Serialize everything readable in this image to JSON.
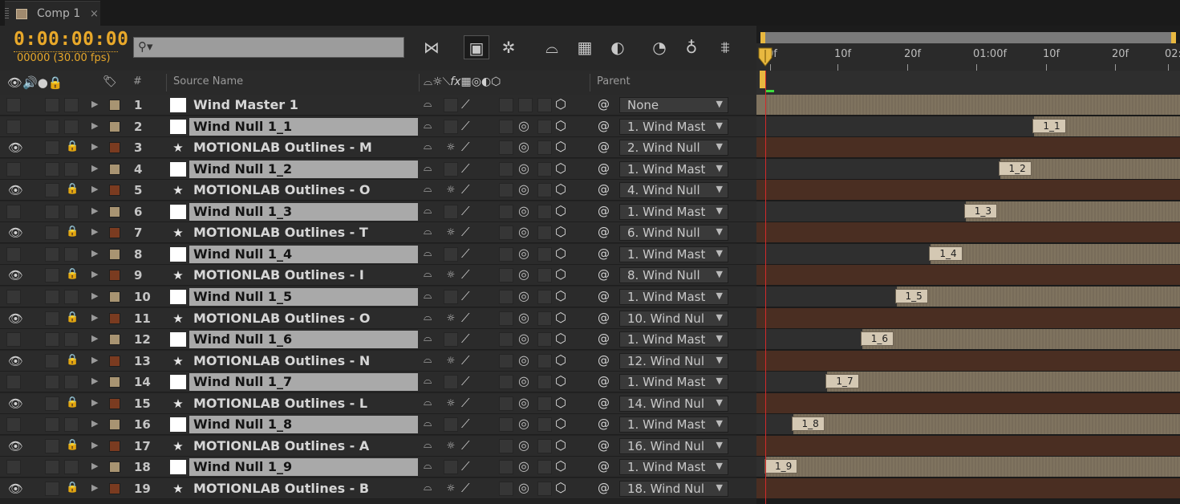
{
  "tab": {
    "title": "Comp 1",
    "close": "×"
  },
  "toolbar": {
    "timecode": "0:00:00:00",
    "frames": "00000 (30.00 fps)",
    "search_placeholder": ""
  },
  "header": {
    "num": "#",
    "source_name": "Source Name",
    "parent": "Parent"
  },
  "ruler_labels": [
    "0f",
    "10f",
    "20f",
    "01:00f",
    "10f",
    "20f",
    "02:"
  ],
  "colors": {
    "accent": "#e8a82a",
    "null_label": "#a89472",
    "shape_label": "#7a3b20",
    "null_bar": "#7f735f",
    "shape_bar": "#4a2e22",
    "selected_name": "#a9a9a9",
    "playhead": "#d22a2a"
  },
  "layers": [
    {
      "num": "1",
      "name": "Wind Master 1",
      "type": "solid",
      "parent": "None",
      "visible": false,
      "locked": false,
      "selected": false,
      "marker": "",
      "bar_start": 0.0
    },
    {
      "num": "2",
      "name": "Wind Null 1_1",
      "type": "solid",
      "parent": "1. Wind Mast",
      "visible": false,
      "locked": false,
      "selected": true,
      "marker": "1_1",
      "bar_start": 0.648
    },
    {
      "num": "3",
      "name": "MOTIONLAB Outlines - M",
      "type": "shape",
      "parent": "2. Wind Null",
      "visible": true,
      "locked": true,
      "selected": false,
      "marker": "",
      "bar_start": 0.0
    },
    {
      "num": "4",
      "name": "Wind Null 1_2",
      "type": "solid",
      "parent": "1. Wind Mast",
      "visible": false,
      "locked": false,
      "selected": true,
      "marker": "1_2",
      "bar_start": 0.565
    },
    {
      "num": "5",
      "name": "MOTIONLAB Outlines - O",
      "type": "shape",
      "parent": "4. Wind Null",
      "visible": true,
      "locked": true,
      "selected": false,
      "marker": "",
      "bar_start": 0.0
    },
    {
      "num": "6",
      "name": "Wind Null 1_3",
      "type": "solid",
      "parent": "1. Wind Mast",
      "visible": false,
      "locked": false,
      "selected": true,
      "marker": "1_3",
      "bar_start": 0.482
    },
    {
      "num": "7",
      "name": "MOTIONLAB Outlines - T",
      "type": "shape",
      "parent": "6. Wind Null",
      "visible": true,
      "locked": true,
      "selected": false,
      "marker": "",
      "bar_start": 0.0
    },
    {
      "num": "8",
      "name": "Wind Null 1_4",
      "type": "solid",
      "parent": "1. Wind Mast",
      "visible": false,
      "locked": false,
      "selected": true,
      "marker": "1_4",
      "bar_start": 0.398
    },
    {
      "num": "9",
      "name": "MOTIONLAB Outlines - I",
      "type": "shape",
      "parent": "8. Wind Null",
      "visible": true,
      "locked": true,
      "selected": false,
      "marker": "",
      "bar_start": 0.0
    },
    {
      "num": "10",
      "name": "Wind Null 1_5",
      "type": "solid",
      "parent": "1. Wind Mast",
      "visible": false,
      "locked": false,
      "selected": true,
      "marker": "1_5",
      "bar_start": 0.315
    },
    {
      "num": "11",
      "name": "MOTIONLAB Outlines - O",
      "type": "shape",
      "parent": "10. Wind Nul",
      "visible": true,
      "locked": true,
      "selected": false,
      "marker": "",
      "bar_start": 0.0
    },
    {
      "num": "12",
      "name": "Wind Null 1_6",
      "type": "solid",
      "parent": "1. Wind Mast",
      "visible": false,
      "locked": false,
      "selected": true,
      "marker": "1_6",
      "bar_start": 0.232
    },
    {
      "num": "13",
      "name": "MOTIONLAB Outlines - N",
      "type": "shape",
      "parent": "12. Wind Nul",
      "visible": true,
      "locked": true,
      "selected": false,
      "marker": "",
      "bar_start": 0.0
    },
    {
      "num": "14",
      "name": "Wind Null 1_7",
      "type": "solid",
      "parent": "1. Wind Mast",
      "visible": false,
      "locked": false,
      "selected": true,
      "marker": "1_7",
      "bar_start": 0.148
    },
    {
      "num": "15",
      "name": "MOTIONLAB Outlines - L",
      "type": "shape",
      "parent": "14. Wind Nul",
      "visible": true,
      "locked": true,
      "selected": false,
      "marker": "",
      "bar_start": 0.0
    },
    {
      "num": "16",
      "name": "Wind Null 1_8",
      "type": "solid",
      "parent": "1. Wind Mast",
      "visible": false,
      "locked": false,
      "selected": true,
      "marker": "1_8",
      "bar_start": 0.065
    },
    {
      "num": "17",
      "name": "MOTIONLAB Outlines - A",
      "type": "shape",
      "parent": "16. Wind Nul",
      "visible": true,
      "locked": true,
      "selected": false,
      "marker": "",
      "bar_start": 0.0
    },
    {
      "num": "18",
      "name": "Wind Null 1_9",
      "type": "solid",
      "parent": "1. Wind Mast",
      "visible": false,
      "locked": false,
      "selected": true,
      "marker": "1_9",
      "bar_start": 0.0
    },
    {
      "num": "19",
      "name": "MOTIONLAB Outlines - B",
      "type": "shape",
      "parent": "18. Wind Nul",
      "visible": true,
      "locked": true,
      "selected": false,
      "marker": "",
      "bar_start": 0.0
    }
  ]
}
